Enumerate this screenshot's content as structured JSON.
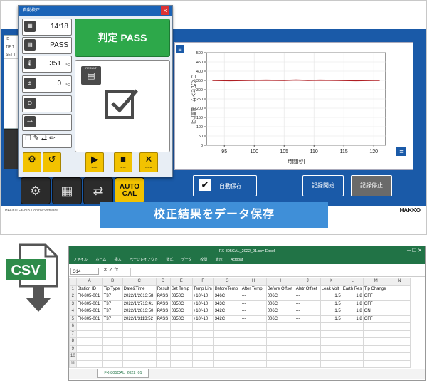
{
  "app": {
    "dialog": {
      "title": "自動校正",
      "time_label": "DATE",
      "time": "14:18",
      "result_label": "RESULT",
      "result": "PASS",
      "temp_label": "TEMP",
      "temp": "351",
      "temp_unit": "°C",
      "offset_label": "OFFSET",
      "offset": "0",
      "offset_unit": "°C",
      "hv_label": "HV",
      "ohm_label": "OHM",
      "judge_button": "判定 PASS",
      "result_box_label": "RESULT",
      "buttons": [
        {
          "icon": "⚙",
          "label": ""
        },
        {
          "icon": "↺",
          "label": ""
        },
        {
          "icon": "▶",
          "label": "START"
        },
        {
          "icon": "■",
          "label": "STOP"
        },
        {
          "icon": "✕",
          "label": "CLOSE"
        }
      ]
    },
    "sidebar": [
      "ID",
      "TIP T",
      "SET T"
    ],
    "bottom_icons": [
      "gear",
      "board",
      "arrows",
      "AUTO CAL"
    ],
    "auto_cal": {
      "line1": "AUTO",
      "line2": "CAL"
    },
    "chart_buttons": {
      "autosave": "自動保存",
      "record_start": "記録開始",
      "record_stop": "記録停止"
    },
    "footer_left": "HAKKO FX-805 Control Software",
    "footer_right": "HAKKO",
    "banner": "校正結果をデータ保存"
  },
  "chart_data": {
    "type": "line",
    "xlabel": "時間[秒]",
    "ylabel": "こて先センサー温度[°C]",
    "xticks": [
      95,
      100,
      105,
      110,
      115,
      120
    ],
    "yticks": [
      0,
      50,
      100,
      150,
      200,
      250,
      300,
      350,
      400,
      450,
      500
    ],
    "xlim": [
      92,
      122
    ],
    "ylim": [
      0,
      500
    ],
    "series": [
      {
        "x": [
          93,
          96,
          99,
          102,
          105,
          107,
          109,
          111,
          114,
          117,
          120,
          121
        ],
        "y": [
          350,
          349,
          350,
          351,
          350,
          352,
          350,
          351,
          350,
          349,
          350,
          350
        ],
        "color": "#b01e23"
      }
    ],
    "grid": true
  },
  "csv": {
    "label": "CSV"
  },
  "excel": {
    "title": "FX-805CAL_2022_01.csv-Excel",
    "window_controls": "─  ☐  ✕",
    "ribbon": [
      "ファイル",
      "ホーム",
      "挿入",
      "ページレイアウト",
      "数式",
      "データ",
      "校閲",
      "表示",
      "Acrobat"
    ],
    "name_box": "O14",
    "fx": "✕  ✓  fx",
    "sheet_tab": "FX-805CAL_2022_01",
    "columns": [
      "A",
      "B",
      "C",
      "D",
      "E",
      "F",
      "G",
      "H",
      "I",
      "J",
      "K",
      "L",
      "M",
      "N"
    ],
    "rows": [
      [
        "Station ID",
        "Tip Type",
        "Date&Time",
        "Result",
        "Set Temp",
        "Temp Lim",
        "BeforeTemp",
        "After Temp",
        "Before Offset",
        "Aletr Offset",
        "Leak Volt",
        "Earth Res",
        "Tip Change",
        ""
      ],
      [
        "FX-805-001",
        "T37",
        "2022/1/2613:58",
        "PASS",
        "0350C",
        "+10/-10",
        "346C",
        "---",
        "006C",
        "---",
        "1.5",
        "1.8",
        "OFF",
        ""
      ],
      [
        "FX-805-001",
        "T37",
        "2022/1/2713:41",
        "PASS",
        "0350C",
        "+10/-10",
        "343C",
        "---",
        "006C",
        "---",
        "1.5",
        "1.8",
        "OFF",
        ""
      ],
      [
        "FX-805-001",
        "T37",
        "2022/1/2813:50",
        "PASS",
        "0350C",
        "+10/-10",
        "342C",
        "---",
        "006C",
        "---",
        "1.5",
        "1.8",
        "ON",
        ""
      ],
      [
        "FX-805-001",
        "T37",
        "2022/1/3113:52",
        "PASS",
        "0350C",
        "+10/-10",
        "342C",
        "---",
        "006C",
        "---",
        "1.5",
        "1.8",
        "OFF",
        ""
      ],
      [
        "",
        "",
        "",
        "",
        "",
        "",
        "",
        "",
        "",
        "",
        "",
        "",
        "",
        ""
      ],
      [
        "",
        "",
        "",
        "",
        "",
        "",
        "",
        "",
        "",
        "",
        "",
        "",
        "",
        ""
      ],
      [
        "",
        "",
        "",
        "",
        "",
        "",
        "",
        "",
        "",
        "",
        "",
        "",
        "",
        ""
      ],
      [
        "",
        "",
        "",
        "",
        "",
        "",
        "",
        "",
        "",
        "",
        "",
        "",
        "",
        ""
      ],
      [
        "",
        "",
        "",
        "",
        "",
        "",
        "",
        "",
        "",
        "",
        "",
        "",
        "",
        ""
      ],
      [
        "",
        "",
        "",
        "",
        "",
        "",
        "",
        "",
        "",
        "",
        "",
        "",
        "",
        ""
      ]
    ]
  }
}
